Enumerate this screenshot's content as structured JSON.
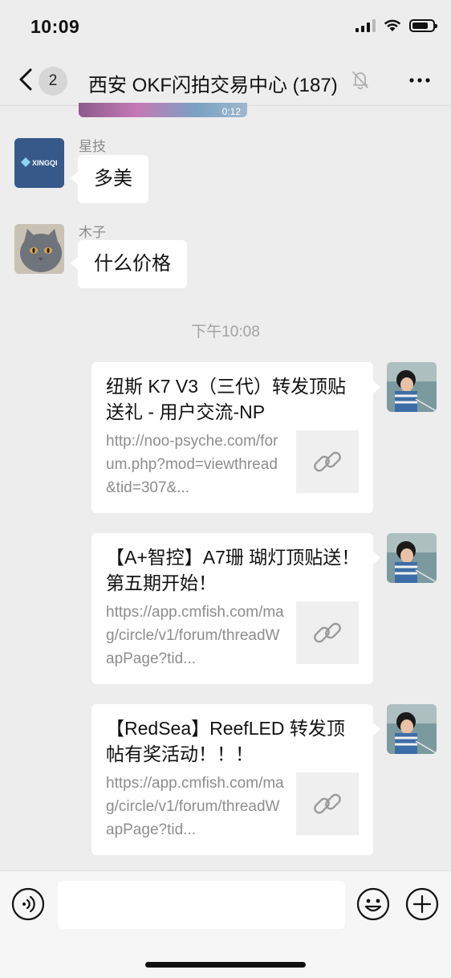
{
  "status": {
    "time": "10:09"
  },
  "nav": {
    "back_count": "2",
    "title": "西安 OKF闪拍交易中心 (187)"
  },
  "partial_media": {
    "duration": "0:12"
  },
  "messages": [
    {
      "sender": "星技",
      "text": "多美",
      "avatar_text": "XINGQI"
    },
    {
      "sender": "木子",
      "text": "什么价格"
    }
  ],
  "timestamp": "下午10:08",
  "links": [
    {
      "title": "纽斯 K7 V3（三代）转发顶贴送礼 - 用户交流-NP",
      "desc": "http://noo-psyche.com/forum.php?mod=viewthread&tid=307&..."
    },
    {
      "title": "【A+智控】A7珊 瑚灯顶贴送！第五期开始！",
      "desc": "https://app.cmfish.com/mag/circle/v1/forum/threadWapPage?tid..."
    },
    {
      "title": "【RedSea】ReefLED 转发顶帖有奖活动！！！",
      "desc": "https://app.cmfish.com/mag/circle/v1/forum/threadWapPage?tid..."
    }
  ],
  "icons": {
    "back": "chevron-left-icon",
    "mute": "bell-slash-icon",
    "more": "more-icon",
    "voice": "voice-icon",
    "emoji": "emoji-icon",
    "plus": "plus-icon",
    "link": "link-icon"
  }
}
